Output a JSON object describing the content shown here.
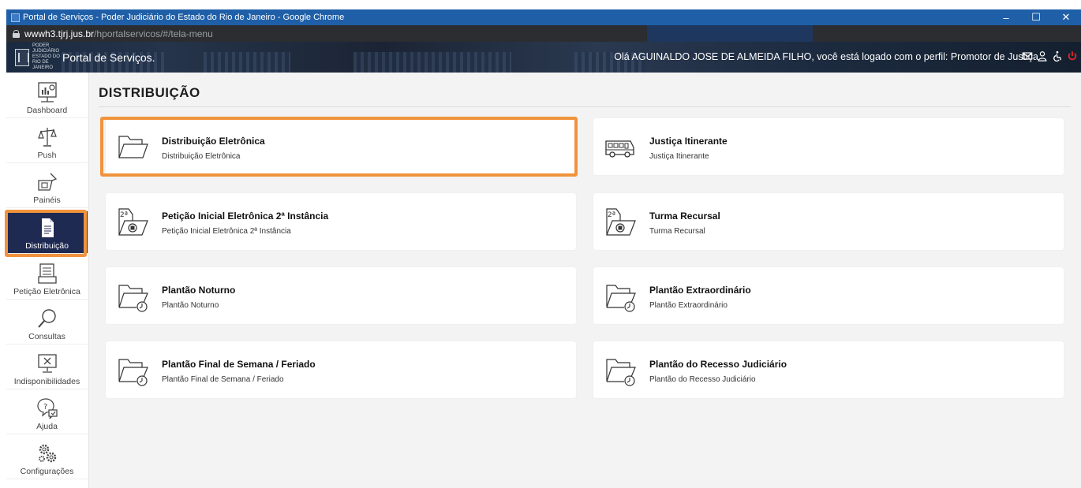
{
  "browser": {
    "window_title": "Portal de Serviços - Poder Judiciário do Estado do Rio de Janeiro - Google Chrome",
    "url_host": "wwwh3.tjrj.jus.br",
    "url_path": "/hportalservicos/#/tela-menu",
    "controls": {
      "minimize": "–",
      "maximize": "☐",
      "close": "✕"
    }
  },
  "header": {
    "brand_small": "PODER JUDICIÁRIO ESTADO DO RIO DE JANEIRO",
    "portal_title": "Portal de Serviços.",
    "user_greeting": "Olá AGUINALDO JOSE DE ALMEIDA FILHO, você está logado com o perfil: Promotor de Justiça",
    "icons": [
      "mail-icon",
      "user-icon",
      "accessibility-icon",
      "power-icon"
    ]
  },
  "sidebar": {
    "items": [
      {
        "label": "Dashboard",
        "icon": "dashboard-icon"
      },
      {
        "label": "Push",
        "icon": "scales-icon"
      },
      {
        "label": "Painéis",
        "icon": "panels-icon"
      },
      {
        "label": "Distribuição",
        "icon": "document-icon",
        "active": true
      },
      {
        "label": "Petição Eletrônica",
        "icon": "petition-icon"
      },
      {
        "label": "Consultas",
        "icon": "magnifier-icon"
      },
      {
        "label": "Indisponibilidades",
        "icon": "monitor-x-icon"
      },
      {
        "label": "Ajuda",
        "icon": "help-icon"
      },
      {
        "label": "Configurações",
        "icon": "gears-icon"
      }
    ]
  },
  "main": {
    "title": "DISTRIBUIÇÃO",
    "cards": [
      {
        "title": "Distribuição Eletrônica",
        "subtitle": "Distribuição Eletrônica",
        "icon": "folder-icon",
        "highlighted": true
      },
      {
        "title": "Justiça Itinerante",
        "subtitle": "Justiça Itinerante",
        "icon": "bus-icon"
      },
      {
        "title": "Petição Inicial Eletrônica 2ª Instância",
        "subtitle": "Petição Inicial Eletrônica 2ª Instância",
        "icon": "second-instance-folder-icon",
        "badge": "2ª"
      },
      {
        "title": "Turma Recursal",
        "subtitle": "Turma Recursal",
        "icon": "second-instance-folder-icon",
        "badge": "2ª"
      },
      {
        "title": "Plantão Noturno",
        "subtitle": "Plantão Noturno",
        "icon": "folder-clock-icon"
      },
      {
        "title": "Plantão Extraordinário",
        "subtitle": "Plantão Extraordinário",
        "icon": "folder-clock-icon"
      },
      {
        "title": "Plantão Final de Semana / Feriado",
        "subtitle": "Plantão Final de Semana / Feriado",
        "icon": "folder-clock-icon"
      },
      {
        "title": "Plantão do Recesso Judiciário",
        "subtitle": "Plantão do Recesso Judiciário",
        "icon": "folder-clock-icon"
      }
    ]
  },
  "colors": {
    "highlight": "#f0933c",
    "active_sidebar": "#1e2a52",
    "window_title_bar": "#1f5fa8",
    "content_background": "#f3f3f3"
  }
}
